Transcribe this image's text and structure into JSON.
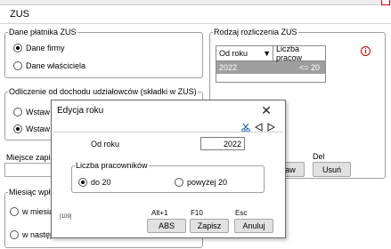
{
  "window": {
    "title": "ZUS"
  },
  "left_panel": {
    "payer_group": {
      "legend": "Dane płatnika ZUS",
      "options": [
        "Dane firmy",
        "Dane właściciela"
      ],
      "selected": 0
    },
    "deduction_group": {
      "legend": "Odliczenie od dochodu udziałowców (składki w ZUS)",
      "options": [
        "Wstaw",
        "Wstaw"
      ],
      "selected": 1
    },
    "entry_label": "Miejsce zapisu",
    "month_group": {
      "legend": "Miesiąc wpł",
      "options": [
        "w miesiąc",
        "w następ"
      ]
    }
  },
  "right_panel": {
    "legend": "Rodzaj rozliczenia ZUS",
    "grid": {
      "columns": [
        "Od roku",
        "Liczba pracow"
      ],
      "rows": [
        {
          "year": "2022",
          "employees": "<= 20"
        }
      ]
    },
    "info_icon": "info-icon",
    "buttons": {
      "edit_partial": "aw",
      "delete_label": "Del",
      "delete_button": "Usuń"
    }
  },
  "dialog": {
    "title": "Edycja roku",
    "close_glyph": "✕",
    "toolbar": [
      "cut-icon",
      "prev-icon",
      "next-icon"
    ],
    "from_year_label": "Od roku",
    "from_year_value": "2022",
    "employees_group": {
      "legend": "Liczba pracowników",
      "options": [
        "do 20",
        "powyżej 20"
      ],
      "selected": 0
    },
    "code_tag": "[109]",
    "buttons": [
      {
        "hotkey": "Alt+1",
        "label": "ABS"
      },
      {
        "hotkey": "F10",
        "label": "Zapisz"
      },
      {
        "hotkey": "Esc",
        "label": "Anuluj"
      }
    ]
  }
}
